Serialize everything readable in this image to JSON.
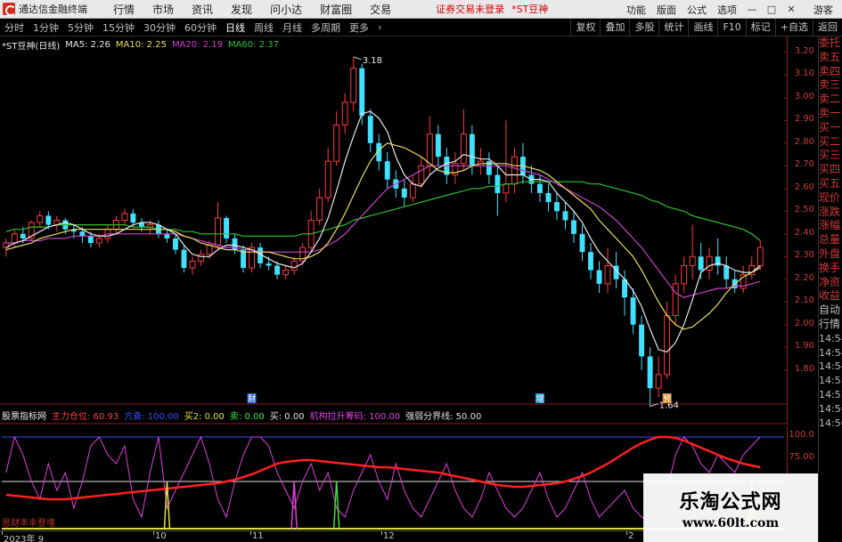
{
  "window": {
    "title": "通达信金融终端",
    "menus": [
      "行情",
      "市场",
      "资讯",
      "发现",
      "问小达",
      "财富圈",
      "交易"
    ],
    "login_status": "证券交易未登录",
    "stock": "*ST豆神",
    "right_menus": [
      "功能",
      "版面",
      "公式",
      "选项"
    ],
    "user": "游客"
  },
  "periods": {
    "tabs": [
      "分时",
      "1分钟",
      "5分钟",
      "15分钟",
      "30分钟",
      "60分钟",
      "日线",
      "周线",
      "月线",
      "多周期",
      "更多"
    ],
    "active": "日线",
    "right_tools": [
      "复权",
      "叠加",
      "多股",
      "统计",
      "画线",
      "F10",
      "标记",
      "+自选",
      "返回"
    ]
  },
  "legend": {
    "title": "*ST豆神(日线)",
    "ma5": "MA5: 2.26",
    "ma10": "MA10: 2.25",
    "ma20": "MA20: 2.19",
    "ma60": "MA60: 2.37"
  },
  "colors": {
    "up": "#ff3b3b",
    "down": "#40e0ff",
    "ma5": "#e8e8e8",
    "ma10": "#e8e060",
    "ma20": "#d040d0",
    "ma60": "#30c030",
    "axis": "#d23a3a"
  },
  "chart_data": {
    "type": "candlestick",
    "ylim": [
      1.65,
      3.27
    ],
    "yticks": [
      "3.20",
      "3.10",
      "3.00",
      "2.90",
      "2.80",
      "2.70",
      "2.60",
      "2.50",
      "2.40",
      "2.30",
      "2.20",
      "2.10",
      "2.00",
      "1.90",
      "1.80"
    ],
    "high_label": "3.18",
    "low_label": "1.64",
    "high": 3.18,
    "low": 1.64,
    "event_markers": [
      {
        "label": "财",
        "color": "#3a6ed8"
      },
      {
        "label": "增",
        "color": "#2c9ad6"
      },
      {
        "label": "预",
        "color": "#d88a2c"
      }
    ],
    "candles": [
      [
        2.34,
        2.36,
        2.3,
        2.38
      ],
      [
        2.36,
        2.4,
        2.34,
        2.42
      ],
      [
        2.4,
        2.38,
        2.36,
        2.43
      ],
      [
        2.38,
        2.45,
        2.37,
        2.46
      ],
      [
        2.45,
        2.48,
        2.43,
        2.5
      ],
      [
        2.48,
        2.44,
        2.42,
        2.5
      ],
      [
        2.44,
        2.46,
        2.41,
        2.48
      ],
      [
        2.46,
        2.42,
        2.4,
        2.47
      ],
      [
        2.42,
        2.41,
        2.38,
        2.44
      ],
      [
        2.41,
        2.39,
        2.36,
        2.43
      ],
      [
        2.39,
        2.36,
        2.34,
        2.41
      ],
      [
        2.36,
        2.38,
        2.34,
        2.4
      ],
      [
        2.38,
        2.42,
        2.36,
        2.44
      ],
      [
        2.42,
        2.46,
        2.4,
        2.48
      ],
      [
        2.46,
        2.49,
        2.44,
        2.51
      ],
      [
        2.49,
        2.45,
        2.43,
        2.51
      ],
      [
        2.45,
        2.43,
        2.41,
        2.47
      ],
      [
        2.43,
        2.44,
        2.4,
        2.46
      ],
      [
        2.44,
        2.4,
        2.38,
        2.46
      ],
      [
        2.4,
        2.38,
        2.36,
        2.42
      ],
      [
        2.38,
        2.33,
        2.31,
        2.4
      ],
      [
        2.33,
        2.25,
        2.23,
        2.35
      ],
      [
        2.25,
        2.28,
        2.22,
        2.3
      ],
      [
        2.28,
        2.31,
        2.26,
        2.33
      ],
      [
        2.31,
        2.35,
        2.29,
        2.37
      ],
      [
        2.35,
        2.47,
        2.33,
        2.54
      ],
      [
        2.47,
        2.38,
        2.36,
        2.48
      ],
      [
        2.38,
        2.33,
        2.31,
        2.4
      ],
      [
        2.33,
        2.25,
        2.23,
        2.35
      ],
      [
        2.25,
        2.34,
        2.23,
        2.36
      ],
      [
        2.34,
        2.27,
        2.25,
        2.36
      ],
      [
        2.27,
        2.26,
        2.24,
        2.3
      ],
      [
        2.26,
        2.22,
        2.2,
        2.28
      ],
      [
        2.22,
        2.24,
        2.2,
        2.26
      ],
      [
        2.24,
        2.28,
        2.22,
        2.3
      ],
      [
        2.28,
        2.34,
        2.26,
        2.36
      ],
      [
        2.34,
        2.46,
        2.32,
        2.5
      ],
      [
        2.46,
        2.56,
        2.44,
        2.6
      ],
      [
        2.56,
        2.72,
        2.54,
        2.78
      ],
      [
        2.72,
        2.88,
        2.7,
        2.94
      ],
      [
        2.88,
        2.98,
        2.84,
        3.02
      ],
      [
        2.98,
        3.13,
        2.94,
        3.18
      ],
      [
        3.13,
        2.92,
        2.88,
        3.15
      ],
      [
        2.92,
        2.8,
        2.76,
        2.95
      ],
      [
        2.8,
        2.72,
        2.68,
        2.84
      ],
      [
        2.72,
        2.64,
        2.6,
        2.76
      ],
      [
        2.64,
        2.6,
        2.56,
        2.68
      ],
      [
        2.6,
        2.56,
        2.52,
        2.64
      ],
      [
        2.56,
        2.62,
        2.54,
        2.66
      ],
      [
        2.62,
        2.7,
        2.6,
        2.74
      ],
      [
        2.7,
        2.84,
        2.66,
        2.92
      ],
      [
        2.84,
        2.74,
        2.7,
        2.88
      ],
      [
        2.74,
        2.66,
        2.62,
        2.78
      ],
      [
        2.66,
        2.71,
        2.62,
        2.76
      ],
      [
        2.71,
        2.84,
        2.68,
        2.95
      ],
      [
        2.84,
        2.7,
        2.66,
        2.88
      ],
      [
        2.7,
        2.72,
        2.66,
        2.78
      ],
      [
        2.72,
        2.66,
        2.62,
        2.76
      ],
      [
        2.66,
        2.58,
        2.48,
        2.7
      ],
      [
        2.58,
        2.62,
        2.54,
        2.9
      ],
      [
        2.62,
        2.74,
        2.58,
        2.78
      ],
      [
        2.74,
        2.66,
        2.62,
        2.8
      ],
      [
        2.66,
        2.62,
        2.58,
        2.7
      ],
      [
        2.62,
        2.58,
        2.54,
        2.66
      ],
      [
        2.58,
        2.54,
        2.5,
        2.62
      ],
      [
        2.54,
        2.5,
        2.46,
        2.58
      ],
      [
        2.5,
        2.46,
        2.42,
        2.54
      ],
      [
        2.46,
        2.4,
        2.36,
        2.5
      ],
      [
        2.4,
        2.32,
        2.28,
        2.44
      ],
      [
        2.32,
        2.24,
        2.2,
        2.36
      ],
      [
        2.24,
        2.18,
        2.14,
        2.28
      ],
      [
        2.18,
        2.26,
        2.14,
        2.34
      ],
      [
        2.26,
        2.2,
        2.16,
        2.32
      ],
      [
        2.2,
        2.12,
        2.04,
        2.24
      ],
      [
        2.12,
        2.0,
        1.96,
        2.16
      ],
      [
        2.0,
        1.86,
        1.8,
        2.04
      ],
      [
        1.86,
        1.72,
        1.64,
        1.9
      ],
      [
        1.72,
        1.78,
        1.68,
        1.86
      ],
      [
        1.78,
        2.04,
        1.76,
        2.1
      ],
      [
        2.04,
        2.18,
        2.0,
        2.22
      ],
      [
        2.18,
        2.26,
        2.14,
        2.3
      ],
      [
        2.26,
        2.3,
        2.2,
        2.44
      ],
      [
        2.3,
        2.24,
        2.2,
        2.36
      ],
      [
        2.24,
        2.3,
        2.2,
        2.34
      ],
      [
        2.3,
        2.26,
        2.22,
        2.38
      ],
      [
        2.26,
        2.2,
        2.16,
        2.3
      ],
      [
        2.2,
        2.16,
        2.14,
        2.24
      ],
      [
        2.16,
        2.22,
        2.14,
        2.26
      ],
      [
        2.22,
        2.26,
        2.2,
        2.3
      ],
      [
        2.26,
        2.34,
        2.24,
        2.37
      ]
    ],
    "ma": {
      "ma5": [
        2.34,
        2.36,
        2.37,
        2.39,
        2.41,
        2.43,
        2.44,
        2.45,
        2.44,
        2.42,
        2.4,
        2.39,
        2.39,
        2.4,
        2.42,
        2.44,
        2.45,
        2.45,
        2.44,
        2.42,
        2.4,
        2.35,
        2.31,
        2.3,
        2.3,
        2.33,
        2.35,
        2.35,
        2.34,
        2.33,
        2.31,
        2.29,
        2.27,
        2.26,
        2.25,
        2.27,
        2.32,
        2.38,
        2.47,
        2.59,
        2.72,
        2.83,
        2.93,
        2.94,
        2.91,
        2.85,
        2.74,
        2.66,
        2.62,
        2.61,
        2.66,
        2.69,
        2.71,
        2.72,
        2.75,
        2.74,
        2.73,
        2.73,
        2.7,
        2.66,
        2.66,
        2.66,
        2.64,
        2.64,
        2.63,
        2.58,
        2.54,
        2.5,
        2.45,
        2.38,
        2.32,
        2.28,
        2.24,
        2.2,
        2.15,
        2.08,
        1.98,
        1.89,
        1.88,
        1.92,
        2.0,
        2.11,
        2.23,
        2.26,
        2.27,
        2.26,
        2.24,
        2.23,
        2.23,
        2.26
      ],
      "ma10": [
        2.33,
        2.34,
        2.35,
        2.36,
        2.38,
        2.39,
        2.4,
        2.41,
        2.42,
        2.42,
        2.42,
        2.42,
        2.42,
        2.42,
        2.42,
        2.42,
        2.42,
        2.42,
        2.42,
        2.42,
        2.41,
        2.39,
        2.38,
        2.36,
        2.35,
        2.34,
        2.33,
        2.33,
        2.32,
        2.32,
        2.32,
        2.32,
        2.31,
        2.3,
        2.29,
        2.29,
        2.3,
        2.32,
        2.36,
        2.42,
        2.49,
        2.57,
        2.65,
        2.72,
        2.77,
        2.8,
        2.79,
        2.78,
        2.76,
        2.74,
        2.71,
        2.68,
        2.67,
        2.67,
        2.68,
        2.7,
        2.71,
        2.71,
        2.71,
        2.71,
        2.7,
        2.7,
        2.69,
        2.68,
        2.66,
        2.63,
        2.6,
        2.57,
        2.54,
        2.51,
        2.46,
        2.42,
        2.38,
        2.34,
        2.3,
        2.24,
        2.17,
        2.1,
        2.04,
        2.0,
        1.98,
        1.99,
        2.02,
        2.05,
        2.09,
        2.14,
        2.18,
        2.21,
        2.23,
        2.25
      ],
      "ma20": [
        2.36,
        2.36,
        2.37,
        2.37,
        2.37,
        2.38,
        2.38,
        2.38,
        2.39,
        2.39,
        2.39,
        2.39,
        2.4,
        2.4,
        2.4,
        2.4,
        2.4,
        2.4,
        2.4,
        2.4,
        2.4,
        2.39,
        2.38,
        2.37,
        2.36,
        2.35,
        2.34,
        2.34,
        2.33,
        2.33,
        2.32,
        2.32,
        2.32,
        2.32,
        2.32,
        2.32,
        2.32,
        2.33,
        2.35,
        2.37,
        2.4,
        2.44,
        2.48,
        2.52,
        2.56,
        2.6,
        2.62,
        2.64,
        2.66,
        2.68,
        2.7,
        2.7,
        2.7,
        2.7,
        2.7,
        2.7,
        2.7,
        2.7,
        2.7,
        2.7,
        2.69,
        2.68,
        2.67,
        2.66,
        2.64,
        2.62,
        2.6,
        2.58,
        2.56,
        2.54,
        2.52,
        2.49,
        2.46,
        2.42,
        2.38,
        2.34,
        2.29,
        2.24,
        2.19,
        2.14,
        2.12,
        2.13,
        2.14,
        2.15,
        2.16,
        2.16,
        2.17,
        2.17,
        2.18,
        2.19
      ],
      "ma60": [
        2.41,
        2.42,
        2.42,
        2.43,
        2.43,
        2.43,
        2.44,
        2.44,
        2.44,
        2.44,
        2.44,
        2.44,
        2.44,
        2.44,
        2.44,
        2.43,
        2.43,
        2.43,
        2.42,
        2.42,
        2.42,
        2.41,
        2.41,
        2.4,
        2.4,
        2.4,
        2.4,
        2.4,
        2.39,
        2.39,
        2.39,
        2.39,
        2.39,
        2.39,
        2.39,
        2.4,
        2.4,
        2.41,
        2.42,
        2.43,
        2.44,
        2.46,
        2.47,
        2.48,
        2.49,
        2.5,
        2.51,
        2.52,
        2.53,
        2.54,
        2.55,
        2.56,
        2.57,
        2.58,
        2.59,
        2.6,
        2.6,
        2.61,
        2.61,
        2.62,
        2.62,
        2.63,
        2.63,
        2.63,
        2.63,
        2.63,
        2.63,
        2.63,
        2.63,
        2.62,
        2.62,
        2.61,
        2.6,
        2.59,
        2.58,
        2.57,
        2.55,
        2.54,
        2.52,
        2.51,
        2.5,
        2.48,
        2.47,
        2.46,
        2.45,
        2.44,
        2.43,
        2.42,
        2.4,
        2.37
      ]
    },
    "indicator": {
      "name": "股票指标网",
      "fields": [
        {
          "label": "主力仓位:",
          "value": "60.93",
          "color": "#ff4040"
        },
        {
          "label": "亢奋:",
          "value": "100.00",
          "color": "#3050ff"
        },
        {
          "label": "买2:",
          "value": "0.00",
          "color": "#e0e040"
        },
        {
          "label": "卖:",
          "value": "0.00",
          "color": "#40e040"
        },
        {
          "label": "买:",
          "value": "0.00",
          "color": "#e0e0e0"
        },
        {
          "label": "机构拉升筹码:",
          "value": "100.00",
          "color": "#e040e0"
        },
        {
          "label": "强弱分界线:",
          "value": "50.00",
          "color": "#e0e0e0"
        }
      ],
      "yticks": [
        "100.0",
        "75.00"
      ],
      "ylim": [
        0,
        110
      ],
      "bottom_note": "思财丰丰登埋",
      "main_line": [
        35,
        34,
        33,
        32,
        31,
        30,
        30,
        30,
        31,
        32,
        33,
        34,
        35,
        36,
        37,
        38,
        39,
        40,
        41,
        42,
        43,
        44,
        45,
        46,
        47,
        48,
        50,
        52,
        55,
        58,
        62,
        66,
        70,
        72,
        73,
        74,
        74,
        73,
        72,
        71,
        70,
        69,
        68,
        67,
        66,
        66,
        65,
        64,
        63,
        62,
        61,
        60,
        58,
        56,
        54,
        52,
        50,
        48,
        46,
        45,
        44,
        44,
        45,
        46,
        47,
        48,
        50,
        53,
        56,
        60,
        65,
        70,
        76,
        82,
        88,
        93,
        97,
        100,
        100,
        99,
        96,
        92,
        88,
        84,
        80,
        76,
        73,
        70,
        68,
        66
      ],
      "wave": [
        60,
        100,
        80,
        50,
        30,
        70,
        40,
        60,
        20,
        50,
        90,
        100,
        80,
        70,
        90,
        30,
        10,
        60,
        100,
        20,
        40,
        60,
        80,
        100,
        70,
        30,
        10,
        50,
        80,
        100,
        100,
        90,
        60,
        40,
        20,
        50,
        70,
        40,
        60,
        20,
        10,
        40,
        60,
        80,
        50,
        30,
        70,
        40,
        20,
        10,
        30,
        50,
        70,
        40,
        20,
        10,
        30,
        60,
        40,
        20,
        10,
        20,
        40,
        60,
        30,
        10,
        20,
        40,
        60,
        30,
        10,
        20,
        30,
        40,
        20,
        10,
        5,
        20,
        40,
        80,
        100,
        90,
        70,
        60,
        80,
        70,
        60,
        80,
        90,
        100
      ]
    },
    "date_labels": [
      "2023年 9",
      "10",
      "11",
      "12",
      "2"
    ],
    "signals": [
      {
        "i": 19,
        "color": "#e0e040"
      },
      {
        "i": 34,
        "color": "#e040e0"
      },
      {
        "i": 39,
        "color": "#40e040"
      },
      {
        "i": 88,
        "color": "#e0e040"
      }
    ]
  },
  "side_panel": {
    "quote_items": [
      "委托",
      "卖五",
      "卖四",
      "卖三",
      "卖二",
      "卖一",
      "买一",
      "买二",
      "买三",
      "买四",
      "买五",
      "现价",
      "涨跌",
      "涨幅",
      "总量",
      "外盘",
      "换手",
      "净资",
      "收益",
      "自动",
      "行情"
    ],
    "times": [
      "14:54",
      "14:54",
      "14:54",
      "14:55",
      "14:55",
      "14:56",
      "14:56"
    ]
  },
  "watermark": {
    "title": "乐淘公式网",
    "url": "www.60lt.com"
  }
}
